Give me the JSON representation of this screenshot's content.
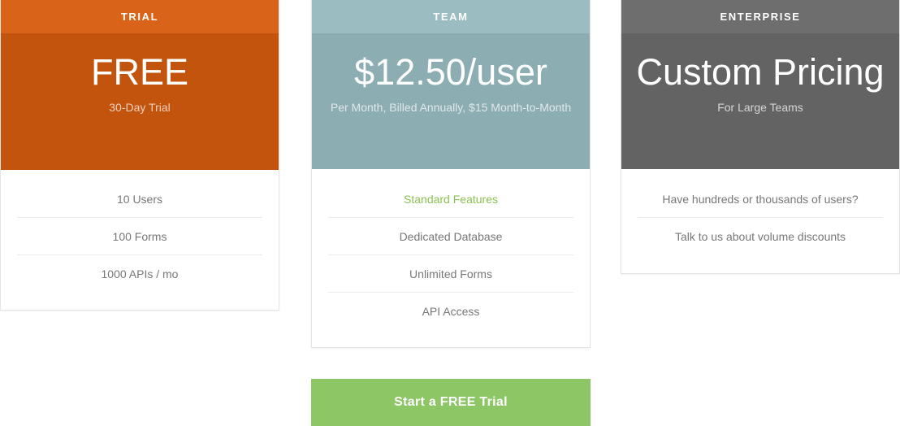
{
  "accent_colors": {
    "trial_banner": "#c3540e",
    "trial_banner_top": "#d96318",
    "team_banner": "#8cadb1",
    "team_banner_top": "#9bbcc0",
    "enterprise_banner": "#636363",
    "enterprise_banner_top": "#6e6e6e",
    "highlight_green": "#8cc152",
    "cta_green": "#8cc665"
  },
  "plans": {
    "trial": {
      "name": "TRIAL",
      "price": "FREE",
      "price_note": "30-Day Trial",
      "features": [
        "10 Users",
        "100 Forms",
        "1000 APIs / mo"
      ]
    },
    "team": {
      "name": "TEAM",
      "price": "$12.50/user",
      "price_note": "Per Month, Billed Annually, $15 Month-to-Month",
      "features": [
        "Standard Features",
        "Dedicated Database",
        "Unlimited Forms",
        "API Access"
      ],
      "highlight_feature_index": 0
    },
    "enterprise": {
      "name": "ENTERPRISE",
      "price": "Custom Pricing",
      "price_note": "For Large Teams",
      "features": [
        "Have hundreds or thousands of users?",
        "Talk to us about volume discounts"
      ]
    }
  },
  "cta": {
    "label": "Start a FREE Trial"
  }
}
